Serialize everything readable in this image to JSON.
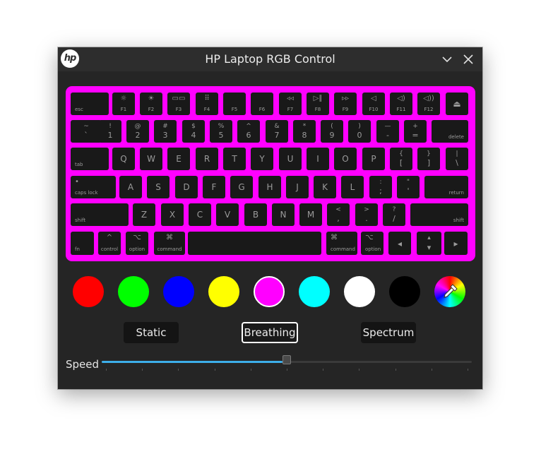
{
  "window": {
    "title": "HP Laptop RGB Control",
    "logo_text": "hp"
  },
  "keyboard_color": "#ff00ff",
  "keyboard": {
    "row1": [
      {
        "key": "esc",
        "bl": "esc"
      },
      {
        "key": "f1",
        "tc": "☼",
        "bc": "F1"
      },
      {
        "key": "f2",
        "tc": "☀",
        "bc": "F2"
      },
      {
        "key": "f3",
        "tc": "▭▭",
        "bc": "F3"
      },
      {
        "key": "f4",
        "tc": "⠿",
        "bc": "F4"
      },
      {
        "key": "f5",
        "bc": "F5"
      },
      {
        "key": "f6",
        "bc": "F6"
      },
      {
        "key": "f7",
        "tc": "◃◃",
        "bc": "F7"
      },
      {
        "key": "f8",
        "tc": "▷∥",
        "bc": "F8"
      },
      {
        "key": "f9",
        "tc": "▹▹",
        "bc": "F9"
      },
      {
        "key": "f10",
        "tc": "◁",
        "bc": "F10"
      },
      {
        "key": "f11",
        "tc": "◁)",
        "bc": "F11"
      },
      {
        "key": "f12",
        "tc": "◁))",
        "bc": "F12"
      },
      {
        "key": "eject",
        "cc": "⏏"
      }
    ],
    "row2": [
      {
        "key": "backtick",
        "t": "~",
        "b": "`"
      },
      {
        "key": "1",
        "t": "!",
        "b": "1"
      },
      {
        "key": "2",
        "t": "@",
        "b": "2"
      },
      {
        "key": "3",
        "t": "#",
        "b": "3"
      },
      {
        "key": "4",
        "t": "$",
        "b": "4"
      },
      {
        "key": "5",
        "t": "%",
        "b": "5"
      },
      {
        "key": "6",
        "t": "^",
        "b": "6"
      },
      {
        "key": "7",
        "t": "&",
        "b": "7"
      },
      {
        "key": "8",
        "t": "*",
        "b": "8"
      },
      {
        "key": "9",
        "t": "(",
        "b": "9"
      },
      {
        "key": "0",
        "t": ")",
        "b": "0"
      },
      {
        "key": "minus",
        "t": "—",
        "b": "-"
      },
      {
        "key": "equals",
        "t": "+",
        "b": "="
      },
      {
        "key": "delete",
        "br": "delete"
      }
    ],
    "row3": [
      {
        "key": "tab",
        "bl": "tab"
      },
      {
        "key": "q",
        "c": "Q"
      },
      {
        "key": "w",
        "c": "W"
      },
      {
        "key": "e",
        "c": "E"
      },
      {
        "key": "r",
        "c": "R"
      },
      {
        "key": "t",
        "c": "T"
      },
      {
        "key": "y",
        "c": "Y"
      },
      {
        "key": "u",
        "c": "U"
      },
      {
        "key": "i",
        "c": "I"
      },
      {
        "key": "o",
        "c": "O"
      },
      {
        "key": "p",
        "c": "P"
      },
      {
        "key": "lbracket",
        "t": "{",
        "b": "["
      },
      {
        "key": "rbracket",
        "t": "}",
        "b": "]"
      },
      {
        "key": "backslash",
        "t": "|",
        "b": "\\"
      }
    ],
    "row4": [
      {
        "key": "capslock",
        "tl": "•",
        "bl": "caps lock"
      },
      {
        "key": "a",
        "c": "A"
      },
      {
        "key": "s",
        "c": "S"
      },
      {
        "key": "d",
        "c": "D"
      },
      {
        "key": "f",
        "c": "F"
      },
      {
        "key": "g",
        "c": "G"
      },
      {
        "key": "h",
        "c": "H"
      },
      {
        "key": "j",
        "c": "J"
      },
      {
        "key": "k",
        "c": "K"
      },
      {
        "key": "l",
        "c": "L"
      },
      {
        "key": "semicolon",
        "t": ":",
        "b": ";"
      },
      {
        "key": "quote",
        "t": "\"",
        "b": "'"
      },
      {
        "key": "return",
        "br": "return"
      }
    ],
    "row5": [
      {
        "key": "lshift",
        "bl": "shift"
      },
      {
        "key": "z",
        "c": "Z"
      },
      {
        "key": "x",
        "c": "X"
      },
      {
        "key": "c",
        "c": "C"
      },
      {
        "key": "v",
        "c": "V"
      },
      {
        "key": "b",
        "c": "B"
      },
      {
        "key": "n",
        "c": "N"
      },
      {
        "key": "m",
        "c": "M"
      },
      {
        "key": "comma",
        "t": "<",
        "b": ","
      },
      {
        "key": "period",
        "t": ">",
        "b": "."
      },
      {
        "key": "slash",
        "t": "?",
        "b": "/"
      },
      {
        "key": "rshift",
        "br": "shift"
      }
    ],
    "row6": [
      {
        "key": "fn",
        "bl": "fn"
      },
      {
        "key": "lcontrol",
        "tc": "^",
        "bc": "control"
      },
      {
        "key": "loption",
        "tc": "⌥",
        "bc": "option"
      },
      {
        "key": "lcommand",
        "tc": "⌘",
        "bc": "command"
      },
      {
        "key": "space"
      },
      {
        "key": "rcommand",
        "tl": "⌘",
        "bl": "command"
      },
      {
        "key": "roption",
        "tl": "⌥",
        "bl": "option"
      },
      {
        "key": "left",
        "cc": "◂"
      },
      {
        "key": "updown",
        "t": "▴",
        "b": "▾"
      },
      {
        "key": "right",
        "cc": "▸"
      }
    ]
  },
  "swatches": [
    {
      "name": "red",
      "color": "#ff0000"
    },
    {
      "name": "green",
      "color": "#00ff00"
    },
    {
      "name": "blue",
      "color": "#0000ff"
    },
    {
      "name": "yellow",
      "color": "#ffff00"
    },
    {
      "name": "magenta",
      "color": "#ff00ff",
      "selected": true
    },
    {
      "name": "cyan",
      "color": "#00ffff"
    },
    {
      "name": "white",
      "color": "#ffffff"
    },
    {
      "name": "black",
      "color": "#000000"
    },
    {
      "name": "custom-color-picker",
      "color": "rainbow"
    }
  ],
  "modes": {
    "static": "Static",
    "breathing": "Breathing",
    "spectrum": "Spectrum",
    "selected": "breathing"
  },
  "speed": {
    "label": "Speed",
    "value": 0.5
  }
}
